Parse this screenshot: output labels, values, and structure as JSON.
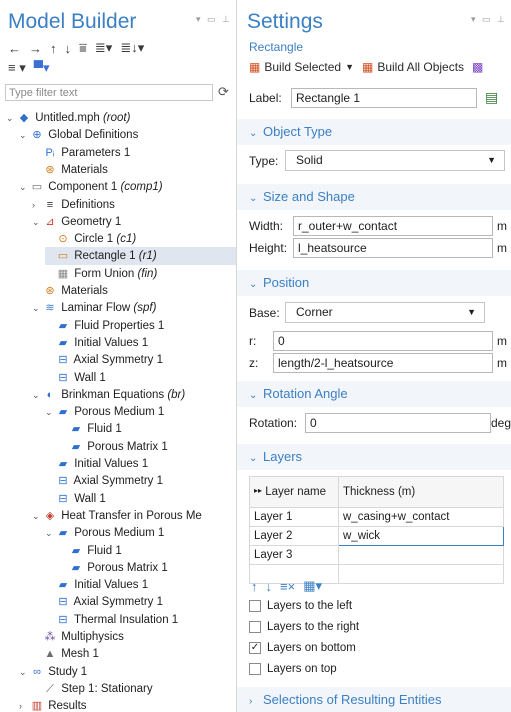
{
  "model_builder": {
    "title": "Model Builder",
    "filter_placeholder": "Type filter text",
    "tree": [
      {
        "label": "Untitled.mph",
        "tag": "(root)",
        "icon": "file-icon",
        "caret": "v"
      },
      {
        "label": "Global Definitions",
        "tag": "",
        "icon": "globe-icon",
        "caret": "v"
      },
      {
        "label": "Parameters 1",
        "tag": "",
        "icon": "parameters-icon",
        "caret": ""
      },
      {
        "label": "Materials",
        "tag": "",
        "icon": "materials-icon",
        "caret": ""
      },
      {
        "label": "Component 1",
        "tag": "(comp1)",
        "icon": "component-icon",
        "caret": "v"
      },
      {
        "label": "Definitions",
        "tag": "",
        "icon": "definitions-icon",
        "caret": ">"
      },
      {
        "label": "Geometry 1",
        "tag": "",
        "icon": "geometry-icon",
        "caret": "v"
      },
      {
        "label": "Circle 1",
        "tag": "(c1)",
        "icon": "circle-icon",
        "caret": ""
      },
      {
        "label": "Rectangle 1",
        "tag": "(r1)",
        "icon": "rectangle-icon",
        "caret": ""
      },
      {
        "label": "Form Union",
        "tag": "(fin)",
        "icon": "form-union-icon",
        "caret": ""
      },
      {
        "label": "Materials",
        "tag": "",
        "icon": "materials-icon",
        "caret": ""
      },
      {
        "label": "Laminar Flow",
        "tag": "(spf)",
        "icon": "laminar-flow-icon",
        "caret": "v"
      },
      {
        "label": "Fluid Properties 1",
        "tag": "",
        "icon": "domain-icon",
        "caret": ""
      },
      {
        "label": "Initial Values 1",
        "tag": "",
        "icon": "domain-icon",
        "caret": ""
      },
      {
        "label": "Axial Symmetry 1",
        "tag": "",
        "icon": "boundary-icon",
        "caret": ""
      },
      {
        "label": "Wall 1",
        "tag": "",
        "icon": "boundary-icon",
        "caret": ""
      },
      {
        "label": "Brinkman Equations",
        "tag": "(br)",
        "icon": "brinkman-icon",
        "caret": "v"
      },
      {
        "label": "Porous Medium 1",
        "tag": "",
        "icon": "domain-icon",
        "caret": "v"
      },
      {
        "label": "Fluid 1",
        "tag": "",
        "icon": "domain-icon",
        "caret": ""
      },
      {
        "label": "Porous Matrix 1",
        "tag": "",
        "icon": "domain-icon",
        "caret": ""
      },
      {
        "label": "Initial Values 1",
        "tag": "",
        "icon": "domain-icon",
        "caret": ""
      },
      {
        "label": "Axial Symmetry 1",
        "tag": "",
        "icon": "boundary-icon",
        "caret": ""
      },
      {
        "label": "Wall 1",
        "tag": "",
        "icon": "boundary-icon",
        "caret": ""
      },
      {
        "label": "Heat Transfer in Porous Me",
        "tag": "",
        "icon": "heat-transfer-icon",
        "caret": "v"
      },
      {
        "label": "Porous Medium 1",
        "tag": "",
        "icon": "domain-icon",
        "caret": "v"
      },
      {
        "label": "Fluid 1",
        "tag": "",
        "icon": "domain-icon",
        "caret": ""
      },
      {
        "label": "Porous Matrix 1",
        "tag": "",
        "icon": "domain-icon",
        "caret": ""
      },
      {
        "label": "Initial Values 1",
        "tag": "",
        "icon": "domain-icon",
        "caret": ""
      },
      {
        "label": "Axial Symmetry 1",
        "tag": "",
        "icon": "boundary-icon",
        "caret": ""
      },
      {
        "label": "Thermal Insulation 1",
        "tag": "",
        "icon": "boundary-icon",
        "caret": ""
      },
      {
        "label": "Multiphysics",
        "tag": "",
        "icon": "multiphysics-icon",
        "caret": ""
      },
      {
        "label": "Mesh 1",
        "tag": "",
        "icon": "mesh-icon",
        "caret": ""
      },
      {
        "label": "Study 1",
        "tag": "",
        "icon": "study-icon",
        "caret": "v"
      },
      {
        "label": "Step 1: Stationary",
        "tag": "",
        "icon": "step-icon",
        "caret": ""
      },
      {
        "label": "Results",
        "tag": "",
        "icon": "results-icon",
        "caret": ">"
      }
    ]
  },
  "settings": {
    "title": "Settings",
    "subtitle": "Rectangle",
    "build_selected": "Build Selected",
    "build_all": "Build All Objects",
    "label_caption": "Label:",
    "label_value": "Rectangle 1",
    "object_type": {
      "header": "Object Type",
      "type_caption": "Type:",
      "type_value": "Solid"
    },
    "size_shape": {
      "header": "Size and Shape",
      "width_caption": "Width:",
      "width_value": "r_outer+w_contact",
      "height_caption": "Height:",
      "height_value": "l_heatsource",
      "unit": "m"
    },
    "position": {
      "header": "Position",
      "base_caption": "Base:",
      "base_value": "Corner",
      "r_caption": "r:",
      "r_value": "0",
      "z_caption": "z:",
      "z_value": "length/2-l_heatsource",
      "unit": "m"
    },
    "rotation": {
      "header": "Rotation Angle",
      "caption": "Rotation:",
      "value": "0",
      "unit": "deg"
    },
    "layers": {
      "header": "Layers",
      "col_name": "Layer name",
      "col_thickness": "Thickness (m)",
      "rows": [
        {
          "name": "Layer 1",
          "thickness": "w_casing+w_contact"
        },
        {
          "name": "Layer 2",
          "thickness": "w_wick"
        },
        {
          "name": "Layer 3",
          "thickness": ""
        }
      ],
      "checks": [
        {
          "label": "Layers to the left",
          "checked": false
        },
        {
          "label": "Layers to the right",
          "checked": false
        },
        {
          "label": "Layers on bottom",
          "checked": true
        },
        {
          "label": "Layers on top",
          "checked": false
        }
      ]
    },
    "selections_header": "Selections of Resulting Entities"
  }
}
